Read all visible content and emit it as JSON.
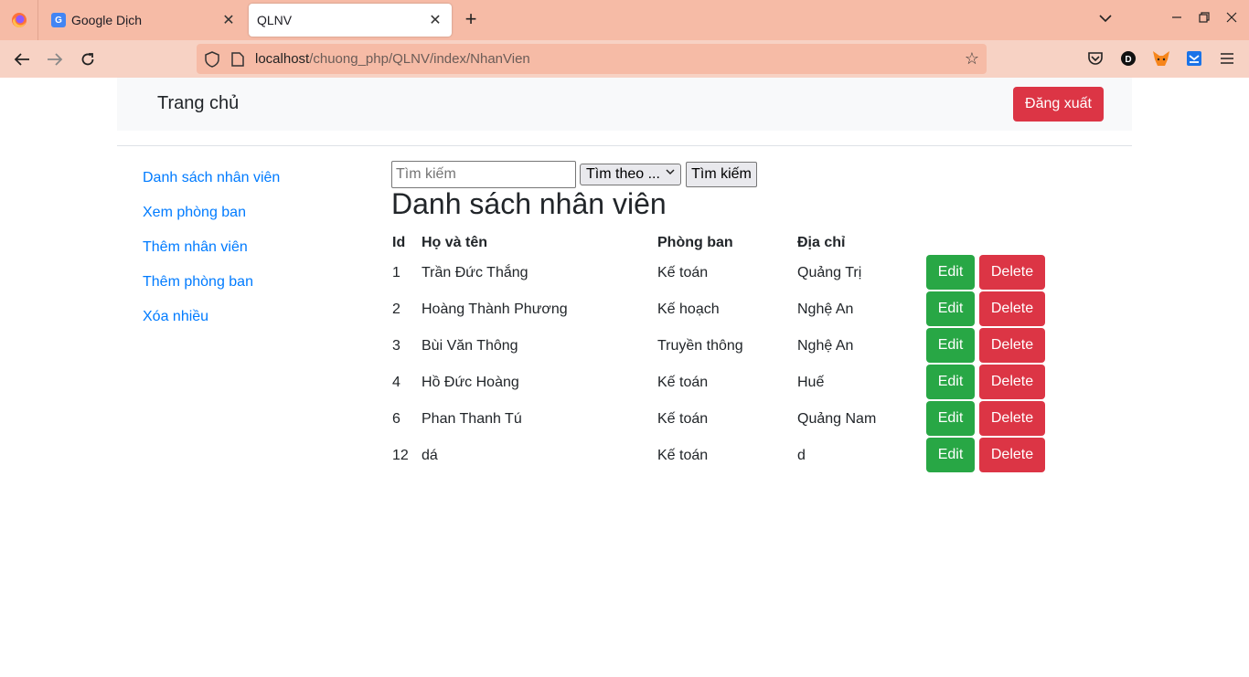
{
  "browser": {
    "tabs": [
      {
        "title": "Google Dịch",
        "active": false,
        "icon": "google-translate-icon"
      },
      {
        "title": "QLNV",
        "active": true
      }
    ],
    "url_host": "localhost",
    "url_path": "/chuong_php/QLNV/index/NhanVien",
    "colors": {
      "tabbar": "#f6bba6",
      "toolbar": "#f7d2c4"
    }
  },
  "header": {
    "brand": "Trang chủ",
    "logout_label": "Đăng xuất"
  },
  "sidebar": {
    "items": [
      {
        "label": "Danh sách nhân viên"
      },
      {
        "label": "Xem phòng ban"
      },
      {
        "label": "Thêm nhân viên"
      },
      {
        "label": "Thêm phòng ban"
      },
      {
        "label": "Xóa nhiều"
      }
    ]
  },
  "search": {
    "placeholder": "Tìm kiếm",
    "value": "",
    "select_value": "Tìm theo ...",
    "button_label": "Tìm kiếm"
  },
  "main": {
    "title": "Danh sách nhân viên",
    "columns": [
      "Id",
      "Họ và tên",
      "Phòng ban",
      "Địa chỉ"
    ],
    "edit_label": "Edit",
    "delete_label": "Delete",
    "rows": [
      {
        "id": "1",
        "name": "Trần Đức Thắng",
        "dept": "Kế toán",
        "address": "Quảng Trị"
      },
      {
        "id": "2",
        "name": "Hoàng Thành Phương",
        "dept": "Kế hoạch",
        "address": "Nghệ An"
      },
      {
        "id": "3",
        "name": "Bùi Văn Thông",
        "dept": "Truyền thông",
        "address": "Nghệ An"
      },
      {
        "id": "4",
        "name": "Hồ Đức Hoàng",
        "dept": "Kế toán",
        "address": "Huế"
      },
      {
        "id": "6",
        "name": "Phan Thanh Tú",
        "dept": "Kế toán",
        "address": "Quảng Nam"
      },
      {
        "id": "12",
        "name": "dá",
        "dept": "Kế toán",
        "address": "d"
      }
    ]
  }
}
